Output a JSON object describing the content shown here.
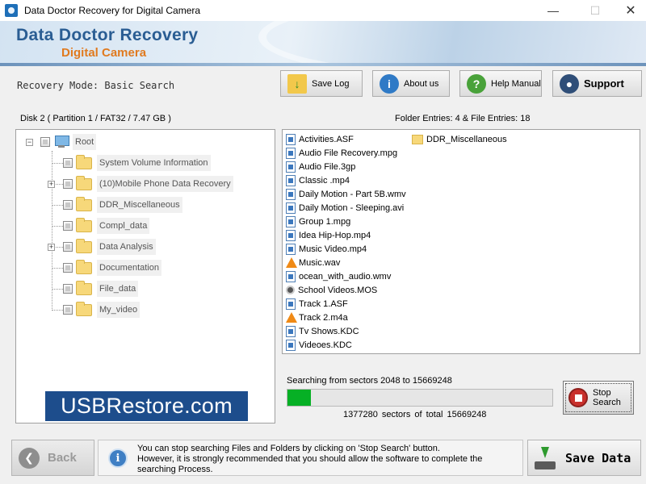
{
  "window": {
    "title": "Data Doctor Recovery for Digital Camera"
  },
  "banner": {
    "line1": "Data Doctor Recovery",
    "line2": "Digital Camera"
  },
  "mode": {
    "label": "Recovery Mode: Basic Search"
  },
  "toolbar": {
    "save_log": "Save Log",
    "about_us": "About us",
    "help_manual": "Help Manual",
    "support": "Support"
  },
  "disk": {
    "label": "Disk 2 ( Partition 1 / FAT32 / 7.47 GB )",
    "entries": "Folder Entries: 4 & File Entries: 18"
  },
  "tree": {
    "root": "Root",
    "folders": [
      "System Volume Information",
      "(10)Mobile Phone Data Recovery",
      "DDR_Miscellaneous",
      "Compl_data",
      "Data Analysis",
      "Documentation",
      "File_data",
      "My_video"
    ]
  },
  "files": {
    "items": [
      "Activities.ASF",
      "Audio File Recovery.mpg",
      "Audio File.3gp",
      "Classic .mp4",
      "Daily Motion - Part 5B.wmv",
      "Daily Motion - Sleeping.avi",
      "Group 1.mpg",
      "Idea Hip-Hop.mp4",
      "Music Video.mp4",
      "Music.wav",
      "ocean_with_audio.wmv",
      "School Videos.MOS",
      "Track 1.ASF",
      "Track 2.m4a",
      "Tv Shows.KDC",
      "Videoes.KDC"
    ],
    "folder_item": "DDR_Miscellaneous"
  },
  "search": {
    "from_text": "Searching from sectors   2048 to 15669248",
    "sector_text": "1377280   sectors  of  total 15669248",
    "progress_fraction": 0.088,
    "stop_label": "Stop Search"
  },
  "watermark": "USBRestore.com",
  "bottom": {
    "back": "Back",
    "message_line1": "You can stop searching Files and Folders by clicking on 'Stop Search' button.",
    "message_line2": "However, it is strongly recommended that you should allow the software to complete the searching Process.",
    "save_data": "Save Data"
  },
  "icons": {
    "info": "i",
    "help": "?",
    "back": "❮"
  },
  "colors": {
    "brand_blue": "#2a5d93",
    "brand_orange": "#e07a1f",
    "progress": "#06b025",
    "watermark_bg": "#1d4d8c"
  }
}
